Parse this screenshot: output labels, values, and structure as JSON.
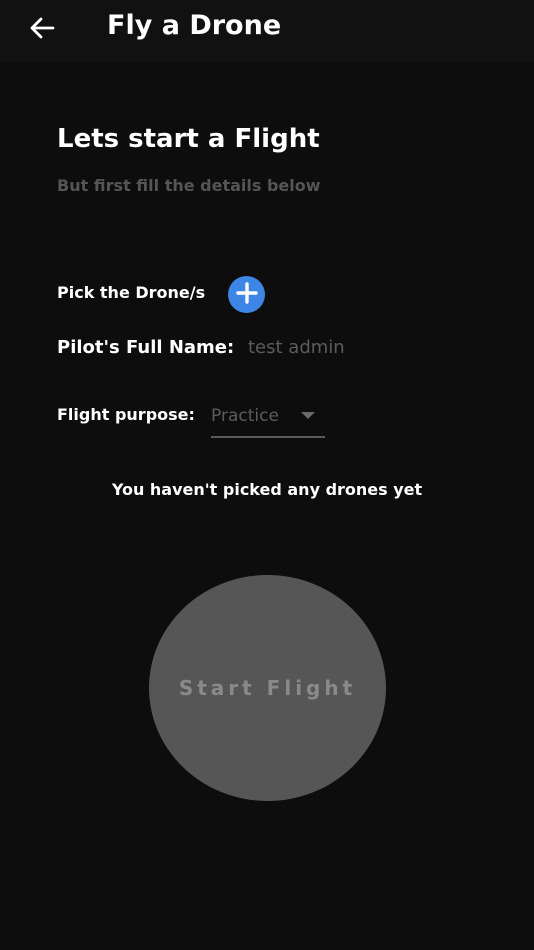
{
  "app_bar": {
    "title": "Fly a Drone",
    "back_icon": "arrow-left-icon"
  },
  "header": {
    "title": "Lets start a Flight",
    "subtitle": "But first fill the details below"
  },
  "form": {
    "drone_label": "Pick the Drone/s",
    "add_drone_icon": "plus-icon",
    "add_button_color": "#3e86e6",
    "pilot_label": "Pilot's Full Name:",
    "pilot_value": "test admin",
    "purpose_label": "Flight purpose:",
    "purpose_value": "Practice",
    "purpose_caret_icon": "caret-down-icon"
  },
  "drones": {
    "empty_message": "You haven't picked any drones yet"
  },
  "start_button": {
    "label": "Start Flight",
    "color": "#565656"
  }
}
